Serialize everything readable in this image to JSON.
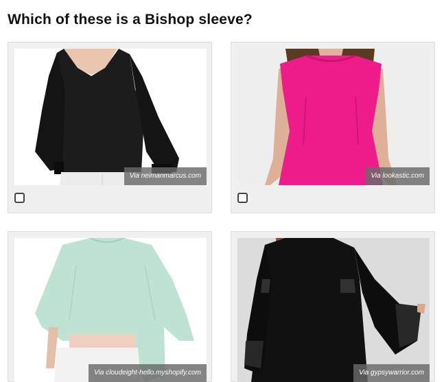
{
  "question": {
    "title": "Which of these is a Bishop sleeve?"
  },
  "options": [
    {
      "credit": "Via neimanmarcus.com",
      "checked": false
    },
    {
      "credit": "Via lookastic.com",
      "checked": false
    },
    {
      "credit": "Via cloudeight-hello.myshopify.com",
      "checked": false
    },
    {
      "credit": "Via gypsywarrior.com",
      "checked": false
    }
  ],
  "colors": {
    "card_bg": "#f0f0f0",
    "option1_garment": "#1a1a1a",
    "option2_garment": "#ee1c8a",
    "option3_garment": "#bfe3d3",
    "option4_garment": "#0f0f0f"
  }
}
